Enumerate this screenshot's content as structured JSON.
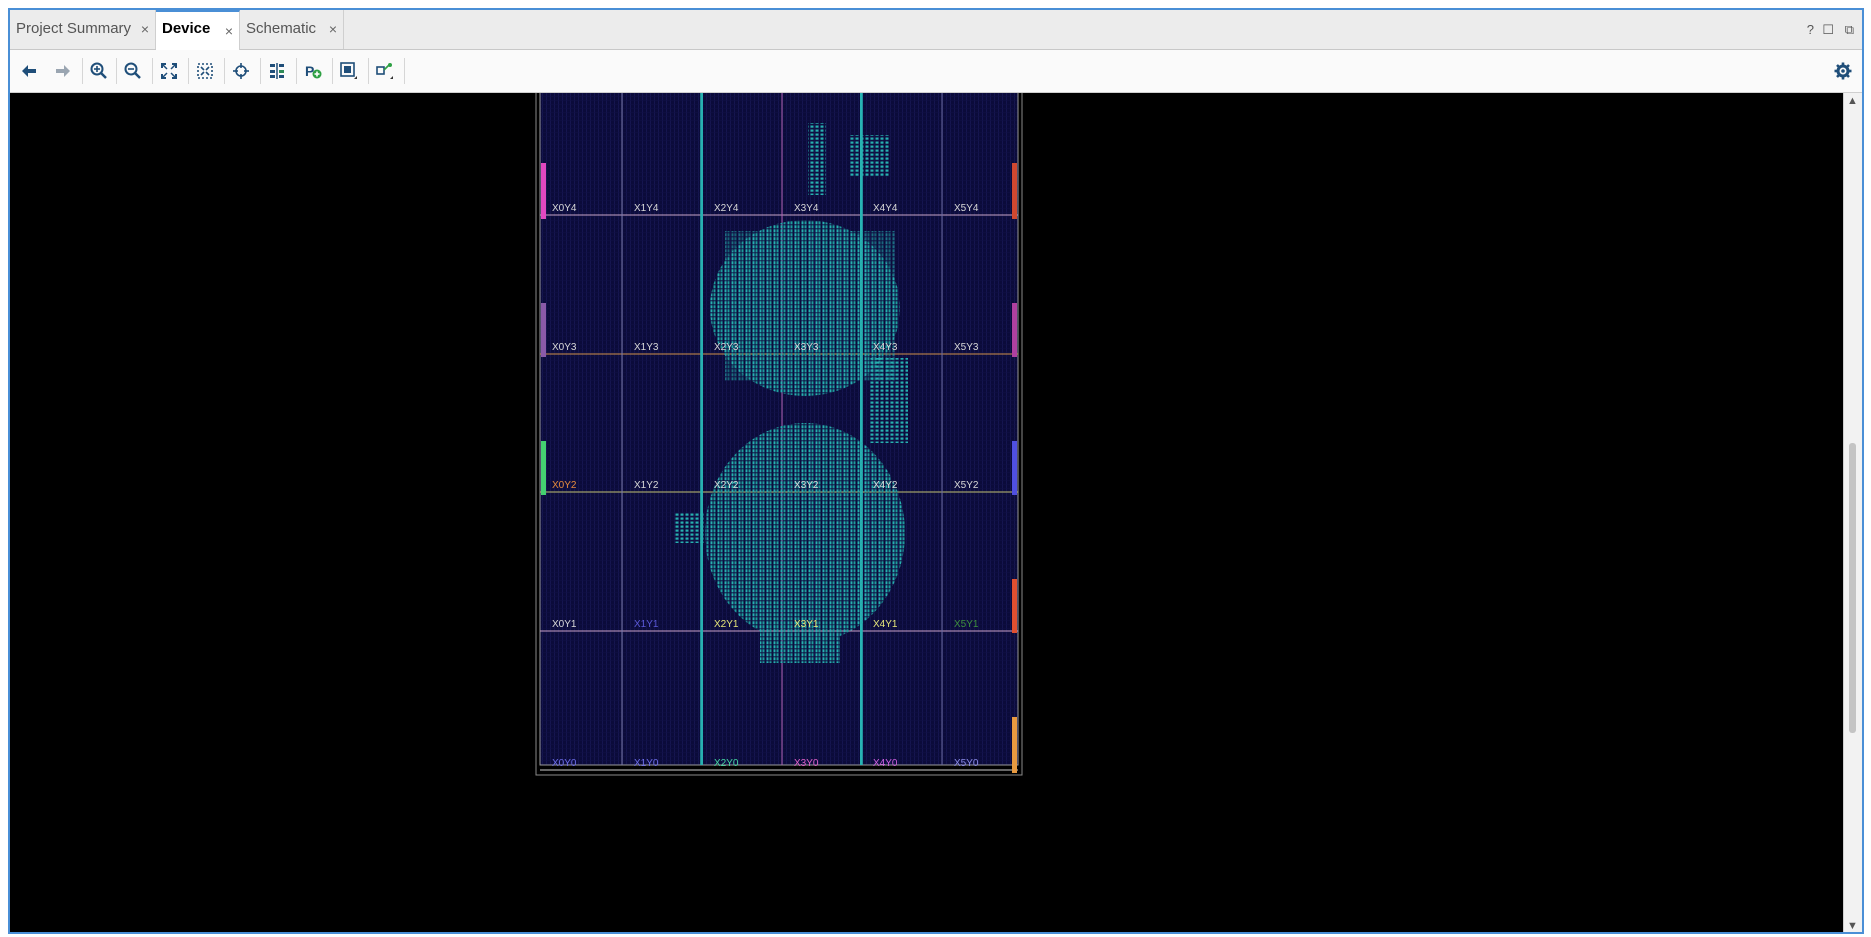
{
  "tabs": [
    {
      "label": "Project Summary",
      "active": false
    },
    {
      "label": "Device",
      "active": true
    },
    {
      "label": "Schematic",
      "active": false
    }
  ],
  "tab_close_glyph": "×",
  "window_controls": {
    "help": "?",
    "maximize": "☐",
    "float": "⧉"
  },
  "toolbar": {
    "back_icon": "arrow-left-icon",
    "forward_icon": "arrow-right-icon",
    "zoom_in_icon": "zoom-in-icon",
    "zoom_out_icon": "zoom-out-icon",
    "zoom_fit_icon": "zoom-fit-icon",
    "zoom_selected_icon": "zoom-selected-icon",
    "crosshair_icon": "crosshair-icon",
    "routing_icon": "routing-resources-icon",
    "add_pblock_icon": "add-pblock-icon",
    "device_view_icon": "device-view-options-icon",
    "connectivity_icon": "connectivity-icon",
    "settings_icon": "gear-icon"
  },
  "device": {
    "clock_regions": [
      [
        "X0Y4",
        "X1Y4",
        "X2Y4",
        "X3Y4",
        "X4Y4",
        "X5Y4"
      ],
      [
        "X0Y3",
        "X1Y3",
        "X2Y3",
        "X3Y3",
        "X4Y3",
        "X5Y3"
      ],
      [
        "X0Y2",
        "X1Y2",
        "X2Y2",
        "X3Y2",
        "X4Y2",
        "X5Y2"
      ],
      [
        "X0Y1",
        "X1Y1",
        "X2Y1",
        "X3Y1",
        "X4Y1",
        "X5Y1"
      ],
      [
        "X0Y0",
        "X1Y0",
        "X2Y0",
        "X3Y0",
        "X4Y0",
        "X5Y0"
      ]
    ],
    "label_colors": [
      [
        "#d8d8d8",
        "#d8d8d8",
        "#d8d8d8",
        "#d8d8d8",
        "#d8d8d8",
        "#d8d8d8"
      ],
      [
        "#d8d8d8",
        "#d8d8d8",
        "#d8d8d8",
        "#d8d8d8",
        "#d8d8d8",
        "#d8d8d8"
      ],
      [
        "#e58a3c",
        "#d8d8d8",
        "#d8d8d8",
        "#d8d8d8",
        "#d8d8d8",
        "#d8d8d8"
      ],
      [
        "#d8d8d8",
        "#5a58d6",
        "#e6e67a",
        "#e6e67a",
        "#e6e67a",
        "#3e8f3e"
      ],
      [
        "#6c6ce6",
        "#6c6ce6",
        "#45d6a0",
        "#e060c8",
        "#d060e0",
        "#8a8ae6"
      ]
    ],
    "placement_color": "#27b0b0",
    "background_color": "#000000",
    "fabric_color": "#0b0b3a"
  }
}
